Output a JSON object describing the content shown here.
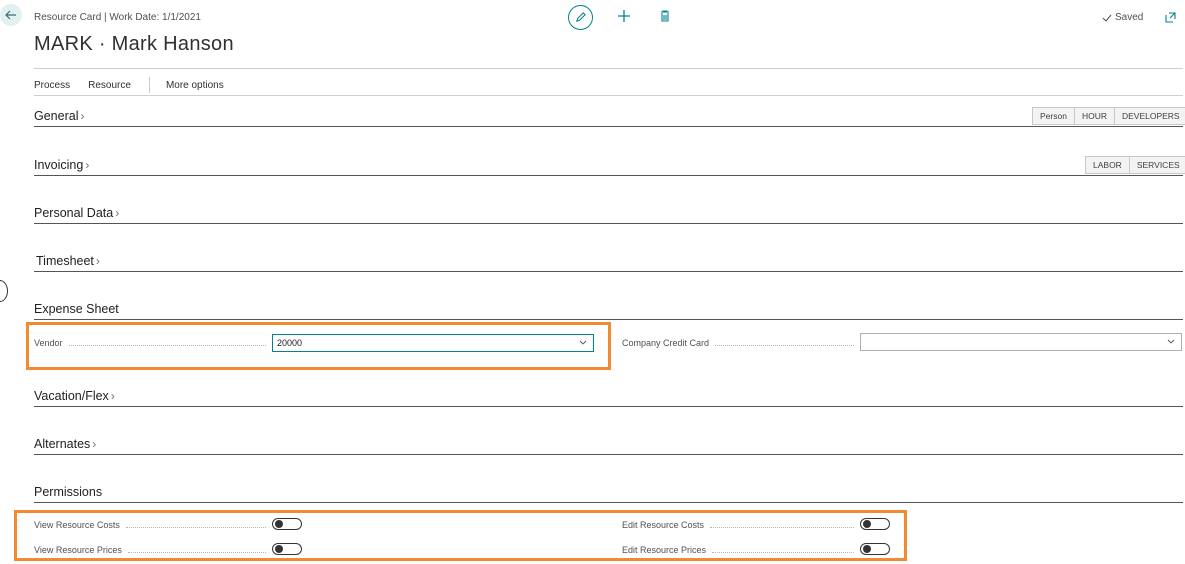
{
  "header": {
    "breadcrumb": "Resource Card | Work Date: 1/1/2021",
    "title": "MARK · Mark Hanson",
    "saved_label": "Saved"
  },
  "menu": {
    "process": "Process",
    "resource": "Resource",
    "more": "More options"
  },
  "sections": {
    "general": "General",
    "invoicing": "Invoicing",
    "personal_data": "Personal Data",
    "timesheet": "Timesheet",
    "expense_sheet": "Expense Sheet",
    "vacation_flex": "Vacation/Flex",
    "alternates": "Alternates",
    "permissions": "Permissions"
  },
  "general_tags": [
    "Person",
    "HOUR",
    "DEVELOPERS"
  ],
  "invoicing_tags": [
    "LABOR",
    "SERVICES"
  ],
  "expense": {
    "vendor_label": "Vendor",
    "vendor_value": "20000",
    "credit_card_label": "Company Credit Card",
    "credit_card_value": ""
  },
  "permissions": {
    "view_costs": "View Resource Costs",
    "view_prices": "View Resource Prices",
    "edit_costs": "Edit Resource Costs",
    "edit_prices": "Edit Resource Prices",
    "view_costs_on": false,
    "view_prices_on": false,
    "edit_costs_on": false,
    "edit_prices_on": false
  },
  "colors": {
    "accent": "#00838f",
    "highlight": "#f28a30"
  },
  "icons": [
    "back-arrow-icon",
    "pencil-icon",
    "plus-icon",
    "trash-icon",
    "checkmark-icon",
    "popout-icon",
    "chevron-down-icon",
    "chevron-right-icon"
  ]
}
